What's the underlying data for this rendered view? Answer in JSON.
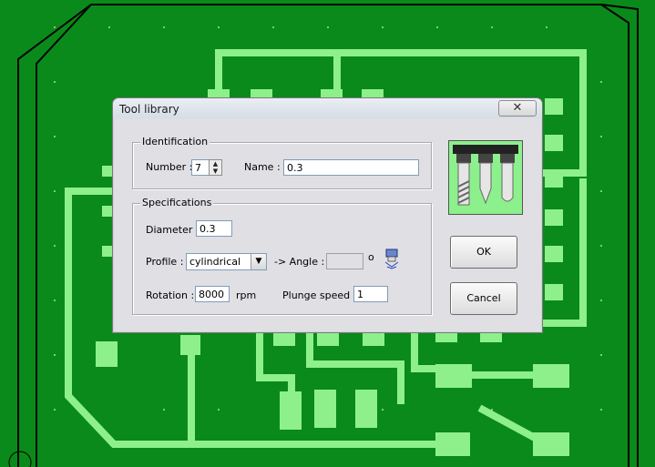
{
  "dialog": {
    "title": "Tool library",
    "close_symbol": "✕",
    "identification": {
      "legend": "Identification",
      "number_label": "Number :",
      "number_value": "7",
      "name_label": "Name :",
      "name_value": "0.3"
    },
    "specifications": {
      "legend": "Specifications",
      "diameter_label": "Diameter :",
      "diameter_value": "0.3",
      "profile_label": "Profile :",
      "profile_value": "cylindrical",
      "angle_label": "-> Angle :",
      "angle_value": "",
      "angle_unit": "o",
      "rotation_label": "Rotation :",
      "rotation_value": "8000",
      "rotation_unit": "rpm",
      "plunge_label": "Plunge speed :",
      "plunge_value": "1"
    },
    "ok_label": "OK",
    "cancel_label": "Cancel",
    "tool_image": "tool-profiles-icon",
    "profile_icon": "cylindrical-profile-icon"
  },
  "colors": {
    "board": "#0a8a1a",
    "trace": "#8ef08a",
    "outline": "#000000"
  }
}
